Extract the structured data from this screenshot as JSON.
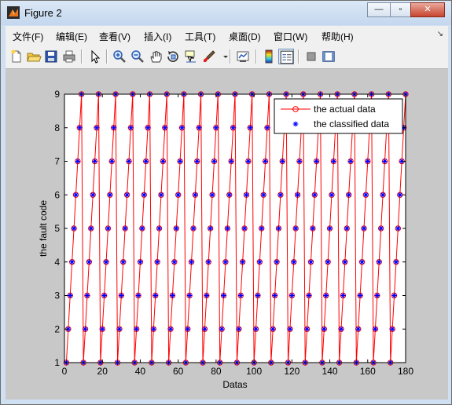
{
  "window": {
    "title": "Figure 2"
  },
  "title_buttons": {
    "minimize": "—",
    "maximize": "▫",
    "close": "✕"
  },
  "menu": {
    "items": [
      "文件(F)",
      "编辑(E)",
      "查看(V)",
      "插入(I)",
      "工具(T)",
      "桌面(D)",
      "窗口(W)",
      "帮助(H)"
    ]
  },
  "toolbar": {
    "buttons": [
      "new-figure-icon",
      "open-file-icon",
      "save-icon",
      "print-icon",
      "arrow-icon",
      "zoom-in-icon",
      "zoom-out-icon",
      "pan-hand-icon",
      "rotate-3d-icon",
      "data-cursor-icon",
      "brush-icon",
      "link-plot-icon",
      "colorbar-icon",
      "legend-icon",
      "hide-plot-tools-icon",
      "show-plot-tools-icon"
    ],
    "active": "legend-icon"
  },
  "colors": {
    "actual": "#ff0000",
    "classified": "#0000ff"
  },
  "chart_data": {
    "type": "line",
    "title": "",
    "xlabel": "Datas",
    "ylabel": "the fault code",
    "xlim": [
      0,
      180
    ],
    "ylim": [
      1,
      9
    ],
    "xticks": [
      "0",
      "20",
      "40",
      "60",
      "80",
      "100",
      "120",
      "140",
      "160",
      "180"
    ],
    "yticks": [
      "1",
      "2",
      "3",
      "4",
      "5",
      "6",
      "7",
      "8",
      "9"
    ],
    "legend": {
      "placement": "top-right",
      "entries": [
        "the actual data",
        "the classified data"
      ]
    },
    "x": [
      1,
      2,
      3,
      4,
      5,
      6,
      7,
      8,
      9,
      10,
      11,
      12,
      13,
      14,
      15,
      16,
      17,
      18,
      19,
      20,
      21,
      22,
      23,
      24,
      25,
      26,
      27,
      28,
      29,
      30,
      31,
      32,
      33,
      34,
      35,
      36,
      37,
      38,
      39,
      40,
      41,
      42,
      43,
      44,
      45,
      46,
      47,
      48,
      49,
      50,
      51,
      52,
      53,
      54,
      55,
      56,
      57,
      58,
      59,
      60,
      61,
      62,
      63,
      64,
      65,
      66,
      67,
      68,
      69,
      70,
      71,
      72,
      73,
      74,
      75,
      76,
      77,
      78,
      79,
      80,
      81,
      82,
      83,
      84,
      85,
      86,
      87,
      88,
      89,
      90,
      91,
      92,
      93,
      94,
      95,
      96,
      97,
      98,
      99,
      100,
      101,
      102,
      103,
      104,
      105,
      106,
      107,
      108,
      109,
      110,
      111,
      112,
      113,
      114,
      115,
      116,
      117,
      118,
      119,
      120,
      121,
      122,
      123,
      124,
      125,
      126,
      127,
      128,
      129,
      130,
      131,
      132,
      133,
      134,
      135,
      136,
      137,
      138,
      139,
      140,
      141,
      142,
      143,
      144,
      145,
      146,
      147,
      148,
      149,
      150,
      151,
      152,
      153,
      154,
      155,
      156,
      157,
      158,
      159,
      160,
      161,
      162,
      163,
      164,
      165,
      166,
      167,
      168,
      169,
      170,
      171,
      172,
      173,
      174,
      175,
      176,
      177,
      178,
      179,
      180
    ],
    "series": [
      {
        "name": "the actual data",
        "values": [
          1,
          2,
          3,
          4,
          5,
          6,
          7,
          8,
          9,
          1,
          2,
          3,
          4,
          5,
          6,
          7,
          8,
          9,
          1,
          2,
          3,
          4,
          5,
          6,
          7,
          8,
          9,
          1,
          2,
          3,
          4,
          5,
          6,
          7,
          8,
          9,
          1,
          2,
          3,
          4,
          5,
          6,
          7,
          8,
          9,
          1,
          2,
          3,
          4,
          5,
          6,
          7,
          8,
          9,
          1,
          2,
          3,
          4,
          5,
          6,
          7,
          8,
          9,
          1,
          2,
          3,
          4,
          5,
          6,
          7,
          8,
          9,
          1,
          2,
          3,
          4,
          5,
          6,
          7,
          8,
          9,
          1,
          2,
          3,
          4,
          5,
          6,
          7,
          8,
          9,
          1,
          2,
          3,
          4,
          5,
          6,
          7,
          8,
          9,
          1,
          2,
          3,
          4,
          5,
          6,
          7,
          8,
          9,
          1,
          2,
          3,
          4,
          5,
          6,
          7,
          8,
          9,
          1,
          2,
          3,
          4,
          5,
          6,
          7,
          8,
          9,
          1,
          2,
          3,
          4,
          5,
          6,
          7,
          8,
          9,
          1,
          2,
          3,
          4,
          5,
          6,
          7,
          8,
          9,
          1,
          2,
          3,
          4,
          5,
          6,
          7,
          8,
          9,
          1,
          2,
          3,
          4,
          5,
          6,
          7,
          8,
          9,
          1,
          2,
          3,
          4,
          5,
          6,
          7,
          8,
          9,
          1,
          2,
          3,
          4,
          5,
          6,
          7,
          8,
          9,
          1,
          2,
          3,
          4,
          5,
          6,
          7,
          8,
          9
        ]
      },
      {
        "name": "the classified data",
        "values": [
          1,
          2,
          3,
          4,
          5,
          6,
          7,
          8,
          9,
          1,
          2,
          3,
          4,
          5,
          6,
          7,
          8,
          9,
          1,
          2,
          3,
          4,
          5,
          6,
          7,
          8,
          9,
          1,
          2,
          3,
          4,
          5,
          6,
          7,
          8,
          9,
          1,
          2,
          3,
          4,
          5,
          6,
          7,
          8,
          9,
          1,
          2,
          3,
          4,
          5,
          6,
          7,
          8,
          9,
          1,
          2,
          3,
          4,
          5,
          6,
          7,
          8,
          9,
          1,
          2,
          3,
          4,
          5,
          6,
          7,
          8,
          9,
          1,
          2,
          3,
          4,
          5,
          6,
          7,
          8,
          9,
          1,
          2,
          3,
          4,
          5,
          6,
          7,
          8,
          9,
          1,
          2,
          3,
          4,
          5,
          6,
          7,
          8,
          9,
          1,
          2,
          3,
          4,
          5,
          6,
          7,
          8,
          9,
          1,
          2,
          3,
          4,
          5,
          6,
          7,
          8,
          9,
          1,
          2,
          3,
          4,
          5,
          6,
          7,
          8,
          9,
          1,
          2,
          3,
          4,
          5,
          6,
          7,
          8,
          9,
          1,
          2,
          3,
          4,
          5,
          6,
          7,
          8,
          9,
          1,
          2,
          3,
          4,
          5,
          6,
          7,
          8,
          9,
          1,
          2,
          3,
          4,
          5,
          6,
          7,
          8,
          9,
          1,
          2,
          3,
          4,
          5,
          6,
          7,
          8,
          9,
          1,
          2,
          3,
          4,
          5,
          6,
          7,
          8,
          9,
          1,
          2,
          3,
          4,
          5,
          6,
          7,
          8,
          9
        ]
      }
    ],
    "grid": false
  }
}
